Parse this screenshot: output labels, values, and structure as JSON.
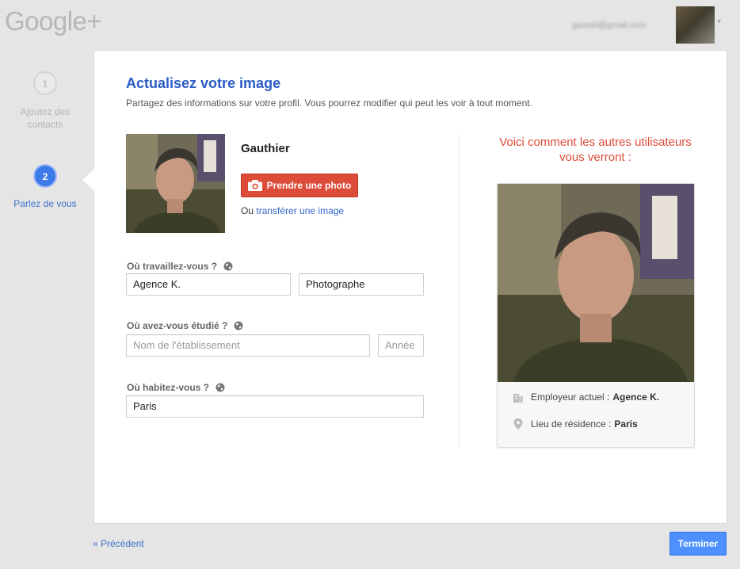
{
  "header": {
    "logo": "Google+",
    "account_email": "gautaii@gmail.com"
  },
  "steps": [
    {
      "number": "1",
      "label": "Ajoutez des contacts"
    },
    {
      "number": "2",
      "label": "Parlez de vous"
    }
  ],
  "main": {
    "title": "Actualisez votre image",
    "subtitle": "Partagez des informations sur votre profil. Vous pourrez modifier qui peut les voir à tout moment.",
    "profile_name": "Gauthier",
    "take_photo_label": "Prendre une photo",
    "upload_prefix": "Ou",
    "upload_link": "transférer une image"
  },
  "work": {
    "label": "Où travaillez-vous ?",
    "employer_value": "Agence K.",
    "title_value": "Photographe"
  },
  "education": {
    "label": "Où avez-vous étudié ?",
    "school_placeholder": "Nom de l'établissement",
    "year_placeholder": "Année"
  },
  "residence": {
    "label": "Où habitez-vous ?",
    "city_value": "Paris"
  },
  "preview": {
    "heading": "Voici comment les autres utilisateurs vous verront :",
    "employer_label": "Employeur actuel :",
    "employer_value": "Agence K.",
    "residence_label": "Lieu de résidence :",
    "residence_value": "Paris"
  },
  "footer": {
    "back_label": "« Précédent",
    "finish_label": "Terminer"
  },
  "colors": {
    "brand_blue": "#2b5bc7",
    "red_button": "#dd4b39",
    "blue_button": "#4d90fe"
  }
}
